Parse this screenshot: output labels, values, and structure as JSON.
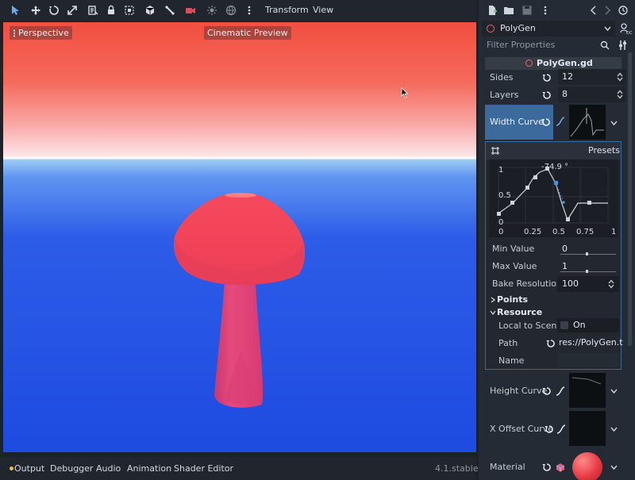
{
  "toolbar": {
    "icons": [
      "select-icon",
      "move-icon",
      "rotate-icon",
      "scale-icon",
      "list-icon",
      "lock-icon",
      "group-icon",
      "bone-icon",
      "camera-icon",
      "sun-icon",
      "globe-icon",
      "more-icon"
    ],
    "menus": [
      "Transform",
      "View"
    ]
  },
  "viewport": {
    "perspective_label": "Perspective",
    "preview_label": "Cinematic Preview",
    "sky_color": "#f24e3f",
    "ground_color": "#2050e2",
    "mesh_color": "#f0475f"
  },
  "bottombar": {
    "tabs": [
      "Output",
      "Debugger",
      "Audio",
      "Animation",
      "Shader Editor"
    ],
    "version": "4.1.stable"
  },
  "inspector": {
    "node_name": "PolyGen",
    "filter_placeholder": "Filter Properties",
    "script_name": "PolyGen.gd",
    "sides_label": "Sides",
    "sides_value": "12",
    "layers_label": "Layers",
    "layers_value": "8",
    "width_curve_label": "Width Curve",
    "presets_label": "Presets",
    "curve_angle": "-74.9 °",
    "curve_y_ticks": [
      "1",
      "0.5",
      "0"
    ],
    "curve_x_ticks": [
      "0",
      "0.25",
      "0.5",
      "0.75",
      "1"
    ],
    "min_value_label": "Min Value",
    "min_value": "0",
    "max_value_label": "Max Value",
    "max_value": "1",
    "bake_label": "Bake Resolution",
    "bake_value": "100",
    "points_section": "Points",
    "resource_section": "Resource",
    "local_to_scene_label": "Local to Scene",
    "local_to_scene_value": "On",
    "path_label": "Path",
    "path_value": "res://PolyGen.t",
    "name_label": "Name",
    "height_curve_label": "Height Curve",
    "x_offset_label": "X Offset Curve",
    "material_label": "Material",
    "accent_color": "#4a8fdc"
  }
}
